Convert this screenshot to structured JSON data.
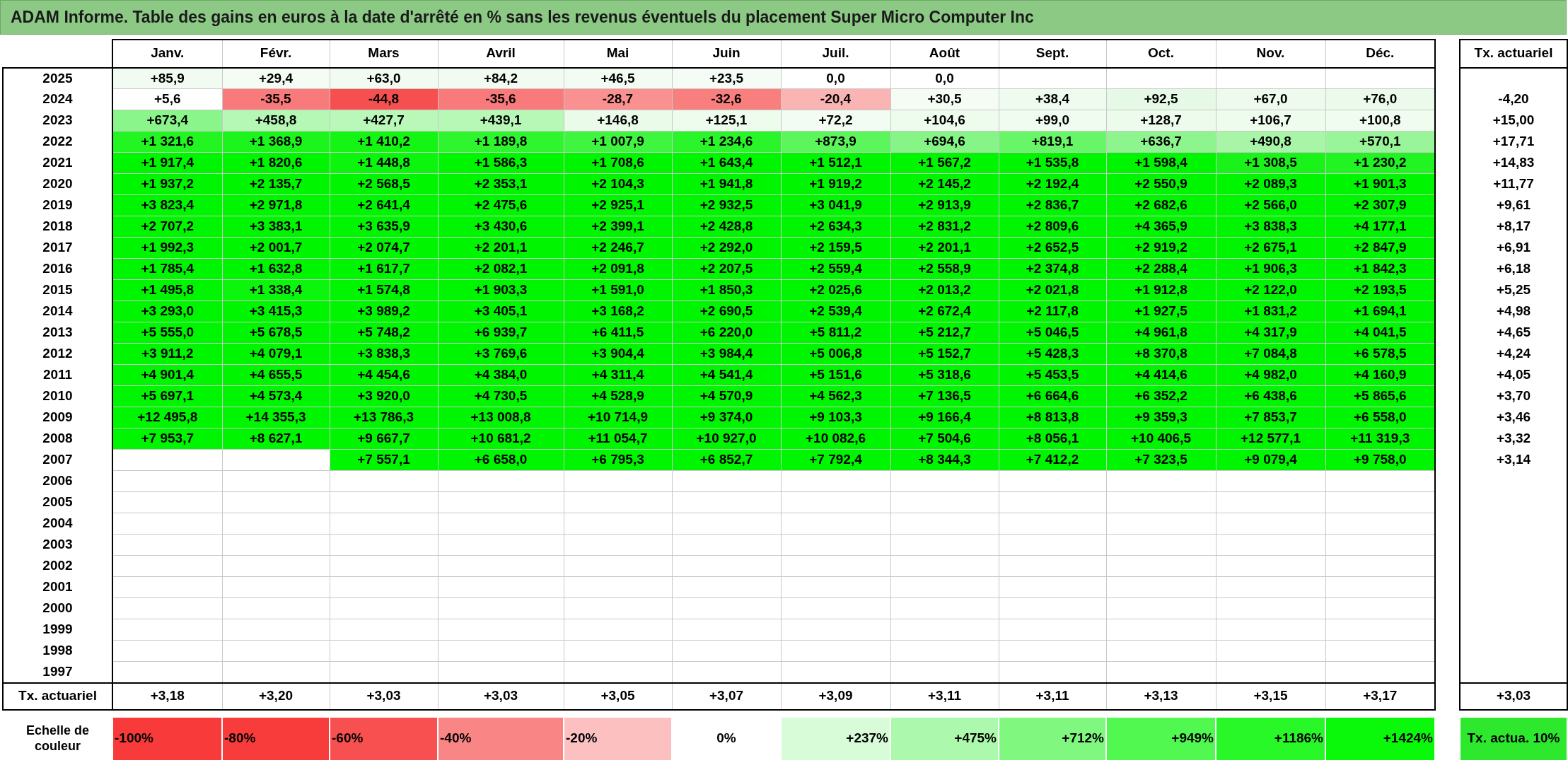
{
  "title": "ADAM Informe. Table des gains en euros à la date d'arrêté en % sans les revenus éventuels du placement Super Micro Computer Inc",
  "months": [
    "Janv.",
    "Févr.",
    "Mars",
    "Avril",
    "Mai",
    "Juin",
    "Juil.",
    "Août",
    "Sept.",
    "Oct.",
    "Nov.",
    "Déc."
  ],
  "rate_heading": "Tx. actuariel",
  "rows": [
    {
      "year": "2025",
      "cells": [
        {
          "value": "+85,9",
          "color": "#f2fbf2"
        },
        {
          "value": "+29,4",
          "color": "#f4fcf4"
        },
        {
          "value": "+63,0",
          "color": "#f2fbf2"
        },
        {
          "value": "+84,2",
          "color": "#f1fbf1"
        },
        {
          "value": "+46,5",
          "color": "#f3fcf3"
        },
        {
          "value": "+23,5",
          "color": "#f5fcf5"
        },
        {
          "value": "0,0",
          "color": "#ffffff"
        },
        {
          "value": "0,0",
          "color": "#ffffff"
        }
      ]
    },
    {
      "year": "2024",
      "rate": "-4,20",
      "cells": [
        {
          "value": "+5,6",
          "color": "#ffffff"
        },
        {
          "value": "-35,5",
          "color": "#f87a7a"
        },
        {
          "value": "-44,8",
          "color": "#f54f4f"
        },
        {
          "value": "-35,6",
          "color": "#f87a7a"
        },
        {
          "value": "-28,7",
          "color": "#fa9090"
        },
        {
          "value": "-32,6",
          "color": "#f97f7f"
        },
        {
          "value": "-20,4",
          "color": "#fbb4b4"
        },
        {
          "value": "+30,5",
          "color": "#f4fcf4"
        },
        {
          "value": "+38,4",
          "color": "#f0fbf0"
        },
        {
          "value": "+92,5",
          "color": "#e6f9e6"
        },
        {
          "value": "+67,0",
          "color": "#eefaee"
        },
        {
          "value": "+76,0",
          "color": "#ecfaec"
        }
      ]
    },
    {
      "year": "2023",
      "rate": "+15,00",
      "cells": [
        {
          "value": "+673,4",
          "color": "#8af58a"
        },
        {
          "value": "+458,8",
          "color": "#b5f7b5"
        },
        {
          "value": "+427,7",
          "color": "#b9f8b9"
        },
        {
          "value": "+439,1",
          "color": "#b7f8b7"
        },
        {
          "value": "+146,8",
          "color": "#eafbea"
        },
        {
          "value": "+125,1",
          "color": "#eefcee"
        },
        {
          "value": "+72,2",
          "color": "#f2fcf2"
        },
        {
          "value": "+104,6",
          "color": "#eefcee"
        },
        {
          "value": "+99,0",
          "color": "#effcef"
        },
        {
          "value": "+128,7",
          "color": "#ecfbec"
        },
        {
          "value": "+106,7",
          "color": "#eefcee"
        },
        {
          "value": "+100,8",
          "color": "#effcef"
        }
      ]
    },
    {
      "year": "2022",
      "rate": "+17,71",
      "cells": [
        {
          "value": "+1 321,6",
          "color": "#22f522"
        },
        {
          "value": "+1 368,9",
          "color": "#1cf51c"
        },
        {
          "value": "+1 410,2",
          "color": "#14f514"
        },
        {
          "value": "+1 189,8",
          "color": "#2ff52f"
        },
        {
          "value": "+1 007,9",
          "color": "#40f540"
        },
        {
          "value": "+1 234,6",
          "color": "#2af42a"
        },
        {
          "value": "+873,9",
          "color": "#5cf55c"
        },
        {
          "value": "+694,6",
          "color": "#86f486"
        },
        {
          "value": "+819,1",
          "color": "#68f568"
        },
        {
          "value": "+636,7",
          "color": "#8ef58e"
        },
        {
          "value": "+490,8",
          "color": "#a8f5a8"
        },
        {
          "value": "+570,1",
          "color": "#9af59a"
        }
      ]
    },
    {
      "year": "2021",
      "rate": "+14,83",
      "cells": [
        {
          "value": "+1 917,4",
          "color": "#00f500"
        },
        {
          "value": "+1 820,6",
          "color": "#00f500"
        },
        {
          "value": "+1 448,8",
          "color": "#0cf50c"
        },
        {
          "value": "+1 586,3",
          "color": "#00f500"
        },
        {
          "value": "+1 708,6",
          "color": "#00f500"
        },
        {
          "value": "+1 643,4",
          "color": "#00f500"
        },
        {
          "value": "+1 512,1",
          "color": "#00f500"
        },
        {
          "value": "+1 567,2",
          "color": "#00f500"
        },
        {
          "value": "+1 535,8",
          "color": "#00f500"
        },
        {
          "value": "+1 598,4",
          "color": "#00f500"
        },
        {
          "value": "+1 308,5",
          "color": "#1af31a"
        },
        {
          "value": "+1 230,2",
          "color": "#22f322"
        }
      ]
    },
    {
      "year": "2020",
      "rate": "+11,77",
      "cells": [
        {
          "value": "+1 937,2",
          "color": "#00f500"
        },
        {
          "value": "+2 135,7",
          "color": "#00f500"
        },
        {
          "value": "+2 568,5",
          "color": "#00f500"
        },
        {
          "value": "+2 353,1",
          "color": "#00f500"
        },
        {
          "value": "+2 104,3",
          "color": "#00f500"
        },
        {
          "value": "+1 941,8",
          "color": "#00f500"
        },
        {
          "value": "+1 919,2",
          "color": "#00f500"
        },
        {
          "value": "+2 145,2",
          "color": "#00f500"
        },
        {
          "value": "+2 192,4",
          "color": "#00f500"
        },
        {
          "value": "+2 550,9",
          "color": "#00f500"
        },
        {
          "value": "+2 089,3",
          "color": "#00f500"
        },
        {
          "value": "+1 901,3",
          "color": "#00f500"
        }
      ]
    },
    {
      "year": "2019",
      "rate": "+9,61",
      "cells": [
        {
          "value": "+3 823,4",
          "color": "#00f500"
        },
        {
          "value": "+2 971,8",
          "color": "#00f500"
        },
        {
          "value": "+2 641,4",
          "color": "#00f500"
        },
        {
          "value": "+2 475,6",
          "color": "#00f500"
        },
        {
          "value": "+2 925,1",
          "color": "#00f500"
        },
        {
          "value": "+2 932,5",
          "color": "#00f500"
        },
        {
          "value": "+3 041,9",
          "color": "#00f500"
        },
        {
          "value": "+2 913,9",
          "color": "#00f500"
        },
        {
          "value": "+2 836,7",
          "color": "#00f500"
        },
        {
          "value": "+2 682,6",
          "color": "#00f500"
        },
        {
          "value": "+2 566,0",
          "color": "#00f500"
        },
        {
          "value": "+2 307,9",
          "color": "#00f500"
        }
      ]
    },
    {
      "year": "2018",
      "rate": "+8,17",
      "cells": [
        {
          "value": "+2 707,2",
          "color": "#00f500"
        },
        {
          "value": "+3 383,1",
          "color": "#00f500"
        },
        {
          "value": "+3 635,9",
          "color": "#00f500"
        },
        {
          "value": "+3 430,6",
          "color": "#00f500"
        },
        {
          "value": "+2 399,1",
          "color": "#00f500"
        },
        {
          "value": "+2 428,8",
          "color": "#00f500"
        },
        {
          "value": "+2 634,3",
          "color": "#00f500"
        },
        {
          "value": "+2 831,2",
          "color": "#00f500"
        },
        {
          "value": "+2 809,6",
          "color": "#00f500"
        },
        {
          "value": "+4 365,9",
          "color": "#00f500"
        },
        {
          "value": "+3 838,3",
          "color": "#00f500"
        },
        {
          "value": "+4 177,1",
          "color": "#00f500"
        }
      ]
    },
    {
      "year": "2017",
      "rate": "+6,91",
      "cells": [
        {
          "value": "+1 992,3",
          "color": "#00f500"
        },
        {
          "value": "+2 001,7",
          "color": "#00f500"
        },
        {
          "value": "+2 074,7",
          "color": "#00f500"
        },
        {
          "value": "+2 201,1",
          "color": "#00f500"
        },
        {
          "value": "+2 246,7",
          "color": "#00f500"
        },
        {
          "value": "+2 292,0",
          "color": "#00f500"
        },
        {
          "value": "+2 159,5",
          "color": "#00f500"
        },
        {
          "value": "+2 201,1",
          "color": "#00f500"
        },
        {
          "value": "+2 652,5",
          "color": "#00f500"
        },
        {
          "value": "+2 919,2",
          "color": "#00f500"
        },
        {
          "value": "+2 675,1",
          "color": "#00f500"
        },
        {
          "value": "+2 847,9",
          "color": "#00f500"
        }
      ]
    },
    {
      "year": "2016",
      "rate": "+6,18",
      "cells": [
        {
          "value": "+1 785,4",
          "color": "#00f500"
        },
        {
          "value": "+1 632,8",
          "color": "#00f500"
        },
        {
          "value": "+1 617,7",
          "color": "#00f500"
        },
        {
          "value": "+2 082,1",
          "color": "#00f500"
        },
        {
          "value": "+2 091,8",
          "color": "#00f500"
        },
        {
          "value": "+2 207,5",
          "color": "#00f500"
        },
        {
          "value": "+2 559,4",
          "color": "#00f500"
        },
        {
          "value": "+2 558,9",
          "color": "#00f500"
        },
        {
          "value": "+2 374,8",
          "color": "#00f500"
        },
        {
          "value": "+2 288,4",
          "color": "#00f500"
        },
        {
          "value": "+1 906,3",
          "color": "#00f500"
        },
        {
          "value": "+1 842,3",
          "color": "#00f500"
        }
      ]
    },
    {
      "year": "2015",
      "rate": "+5,25",
      "cells": [
        {
          "value": "+1 495,8",
          "color": "#00f500"
        },
        {
          "value": "+1 338,4",
          "color": "#0cf50c"
        },
        {
          "value": "+1 574,8",
          "color": "#00f500"
        },
        {
          "value": "+1 903,3",
          "color": "#00f500"
        },
        {
          "value": "+1 591,0",
          "color": "#00f500"
        },
        {
          "value": "+1 850,3",
          "color": "#00f500"
        },
        {
          "value": "+2 025,6",
          "color": "#00f500"
        },
        {
          "value": "+2 013,2",
          "color": "#00f500"
        },
        {
          "value": "+2 021,8",
          "color": "#00f500"
        },
        {
          "value": "+1 912,8",
          "color": "#00f500"
        },
        {
          "value": "+2 122,0",
          "color": "#00f500"
        },
        {
          "value": "+2 193,5",
          "color": "#00f500"
        }
      ]
    },
    {
      "year": "2014",
      "rate": "+4,98",
      "cells": [
        {
          "value": "+3 293,0",
          "color": "#00f500"
        },
        {
          "value": "+3 415,3",
          "color": "#00f500"
        },
        {
          "value": "+3 989,2",
          "color": "#00f500"
        },
        {
          "value": "+3 405,1",
          "color": "#00f500"
        },
        {
          "value": "+3 168,2",
          "color": "#00f500"
        },
        {
          "value": "+2 690,5",
          "color": "#00f500"
        },
        {
          "value": "+2 539,4",
          "color": "#00f500"
        },
        {
          "value": "+2 672,4",
          "color": "#00f500"
        },
        {
          "value": "+2 117,8",
          "color": "#00f500"
        },
        {
          "value": "+1 927,5",
          "color": "#00f500"
        },
        {
          "value": "+1 831,2",
          "color": "#00f500"
        },
        {
          "value": "+1 694,1",
          "color": "#00f500"
        }
      ]
    },
    {
      "year": "2013",
      "rate": "+4,65",
      "cells": [
        {
          "value": "+5 555,0",
          "color": "#00f500"
        },
        {
          "value": "+5 678,5",
          "color": "#00f500"
        },
        {
          "value": "+5 748,2",
          "color": "#00f500"
        },
        {
          "value": "+6 939,7",
          "color": "#00f500"
        },
        {
          "value": "+6 411,5",
          "color": "#00f500"
        },
        {
          "value": "+6 220,0",
          "color": "#00f500"
        },
        {
          "value": "+5 811,2",
          "color": "#00f500"
        },
        {
          "value": "+5 212,7",
          "color": "#00f500"
        },
        {
          "value": "+5 046,5",
          "color": "#00f500"
        },
        {
          "value": "+4 961,8",
          "color": "#00f500"
        },
        {
          "value": "+4 317,9",
          "color": "#00f500"
        },
        {
          "value": "+4 041,5",
          "color": "#00f500"
        }
      ]
    },
    {
      "year": "2012",
      "rate": "+4,24",
      "cells": [
        {
          "value": "+3 911,2",
          "color": "#00f500"
        },
        {
          "value": "+4 079,1",
          "color": "#00f500"
        },
        {
          "value": "+3 838,3",
          "color": "#00f500"
        },
        {
          "value": "+3 769,6",
          "color": "#00f500"
        },
        {
          "value": "+3 904,4",
          "color": "#00f500"
        },
        {
          "value": "+3 984,4",
          "color": "#00f500"
        },
        {
          "value": "+5 006,8",
          "color": "#00f500"
        },
        {
          "value": "+5 152,7",
          "color": "#00f500"
        },
        {
          "value": "+5 428,3",
          "color": "#00f500"
        },
        {
          "value": "+8 370,8",
          "color": "#00f500"
        },
        {
          "value": "+7 084,8",
          "color": "#00f500"
        },
        {
          "value": "+6 578,5",
          "color": "#00f500"
        }
      ]
    },
    {
      "year": "2011",
      "rate": "+4,05",
      "cells": [
        {
          "value": "+4 901,4",
          "color": "#00f500"
        },
        {
          "value": "+4 655,5",
          "color": "#00f500"
        },
        {
          "value": "+4 454,6",
          "color": "#00f500"
        },
        {
          "value": "+4 384,0",
          "color": "#00f500"
        },
        {
          "value": "+4 311,4",
          "color": "#00f500"
        },
        {
          "value": "+4 541,4",
          "color": "#00f500"
        },
        {
          "value": "+5 151,6",
          "color": "#00f500"
        },
        {
          "value": "+5 318,6",
          "color": "#00f500"
        },
        {
          "value": "+5 453,5",
          "color": "#00f500"
        },
        {
          "value": "+4 414,6",
          "color": "#00f500"
        },
        {
          "value": "+4 982,0",
          "color": "#00f500"
        },
        {
          "value": "+4 160,9",
          "color": "#00f500"
        }
      ]
    },
    {
      "year": "2010",
      "rate": "+3,70",
      "cells": [
        {
          "value": "+5 697,1",
          "color": "#00f500"
        },
        {
          "value": "+4 573,4",
          "color": "#00f500"
        },
        {
          "value": "+3 920,0",
          "color": "#00f500"
        },
        {
          "value": "+4 730,5",
          "color": "#00f500"
        },
        {
          "value": "+4 528,9",
          "color": "#00f500"
        },
        {
          "value": "+4 570,9",
          "color": "#00f500"
        },
        {
          "value": "+4 562,3",
          "color": "#00f500"
        },
        {
          "value": "+7 136,5",
          "color": "#00f500"
        },
        {
          "value": "+6 664,6",
          "color": "#00f500"
        },
        {
          "value": "+6 352,2",
          "color": "#00f500"
        },
        {
          "value": "+6 438,6",
          "color": "#00f500"
        },
        {
          "value": "+5 865,6",
          "color": "#00f500"
        }
      ]
    },
    {
      "year": "2009",
      "rate": "+3,46",
      "cells": [
        {
          "value": "+12 495,8",
          "color": "#00f500"
        },
        {
          "value": "+14 355,3",
          "color": "#00f500"
        },
        {
          "value": "+13 786,3",
          "color": "#00f500"
        },
        {
          "value": "+13 008,8",
          "color": "#00f500"
        },
        {
          "value": "+10 714,9",
          "color": "#00f500"
        },
        {
          "value": "+9 374,0",
          "color": "#00f500"
        },
        {
          "value": "+9 103,3",
          "color": "#00f500"
        },
        {
          "value": "+9 166,4",
          "color": "#00f500"
        },
        {
          "value": "+8 813,8",
          "color": "#00f500"
        },
        {
          "value": "+9 359,3",
          "color": "#00f500"
        },
        {
          "value": "+7 853,7",
          "color": "#00f500"
        },
        {
          "value": "+6 558,0",
          "color": "#00f500"
        }
      ]
    },
    {
      "year": "2008",
      "rate": "+3,32",
      "cells": [
        {
          "value": "+7 953,7",
          "color": "#00f500"
        },
        {
          "value": "+8 627,1",
          "color": "#00f500"
        },
        {
          "value": "+9 667,7",
          "color": "#00f500"
        },
        {
          "value": "+10 681,2",
          "color": "#00f500"
        },
        {
          "value": "+11 054,7",
          "color": "#00f500"
        },
        {
          "value": "+10 927,0",
          "color": "#00f500"
        },
        {
          "value": "+10 082,6",
          "color": "#00f500"
        },
        {
          "value": "+7 504,6",
          "color": "#00f500"
        },
        {
          "value": "+8 056,1",
          "color": "#00f500"
        },
        {
          "value": "+10 406,5",
          "color": "#00f500"
        },
        {
          "value": "+12 577,1",
          "color": "#00f500"
        },
        {
          "value": "+11 319,3",
          "color": "#00f500"
        }
      ]
    },
    {
      "year": "2007",
      "rate": "+3,14",
      "cells": [
        null,
        null,
        {
          "value": "+7 557,1",
          "color": "#00f500"
        },
        {
          "value": "+6 658,0",
          "color": "#00f500"
        },
        {
          "value": "+6 795,3",
          "color": "#00f500"
        },
        {
          "value": "+6 852,7",
          "color": "#00f500"
        },
        {
          "value": "+7 792,4",
          "color": "#00f500"
        },
        {
          "value": "+8 344,3",
          "color": "#00f500"
        },
        {
          "value": "+7 412,2",
          "color": "#00f500"
        },
        {
          "value": "+7 323,5",
          "color": "#00f500"
        },
        {
          "value": "+9 079,4",
          "color": "#00f500"
        },
        {
          "value": "+9 758,0",
          "color": "#00f500"
        }
      ]
    },
    {
      "year": "2006"
    },
    {
      "year": "2005"
    },
    {
      "year": "2004"
    },
    {
      "year": "2003"
    },
    {
      "year": "2002"
    },
    {
      "year": "2001"
    },
    {
      "year": "2000"
    },
    {
      "year": "1999"
    },
    {
      "year": "1998"
    },
    {
      "year": "1997"
    }
  ],
  "footer": {
    "label": "Tx. actuariel",
    "values": [
      "+3,18",
      "+3,20",
      "+3,03",
      "+3,03",
      "+3,05",
      "+3,07",
      "+3,09",
      "+3,11",
      "+3,11",
      "+3,13",
      "+3,15",
      "+3,17"
    ],
    "rate": "+3,03"
  },
  "scale": {
    "label": "Echelle de couleur",
    "steps": [
      {
        "label": "-100%",
        "kind": "negative",
        "color": "#f83a3a"
      },
      {
        "label": "-80%",
        "kind": "negative",
        "color": "#f83c3c"
      },
      {
        "label": "-60%",
        "kind": "negative",
        "color": "#f85050"
      },
      {
        "label": "-40%",
        "kind": "negative",
        "color": "#f98585"
      },
      {
        "label": "-20%",
        "kind": "negative",
        "color": "#fcc0c0"
      },
      {
        "label": "0%",
        "kind": "zero",
        "color": "#ffffff"
      },
      {
        "label": "+237%",
        "kind": "positive",
        "color": "#d8fcd8"
      },
      {
        "label": "+475%",
        "kind": "positive",
        "color": "#acf8ac"
      },
      {
        "label": "+712%",
        "kind": "positive",
        "color": "#80f880"
      },
      {
        "label": "+949%",
        "kind": "positive",
        "color": "#50f850"
      },
      {
        "label": "+1186%",
        "kind": "positive",
        "color": "#28f828"
      },
      {
        "label": "+1424%",
        "kind": "positive",
        "color": "#0af80a"
      }
    ],
    "rate_legend": {
      "label": "Tx. actua. 10%",
      "color": "#2ee82e"
    }
  }
}
